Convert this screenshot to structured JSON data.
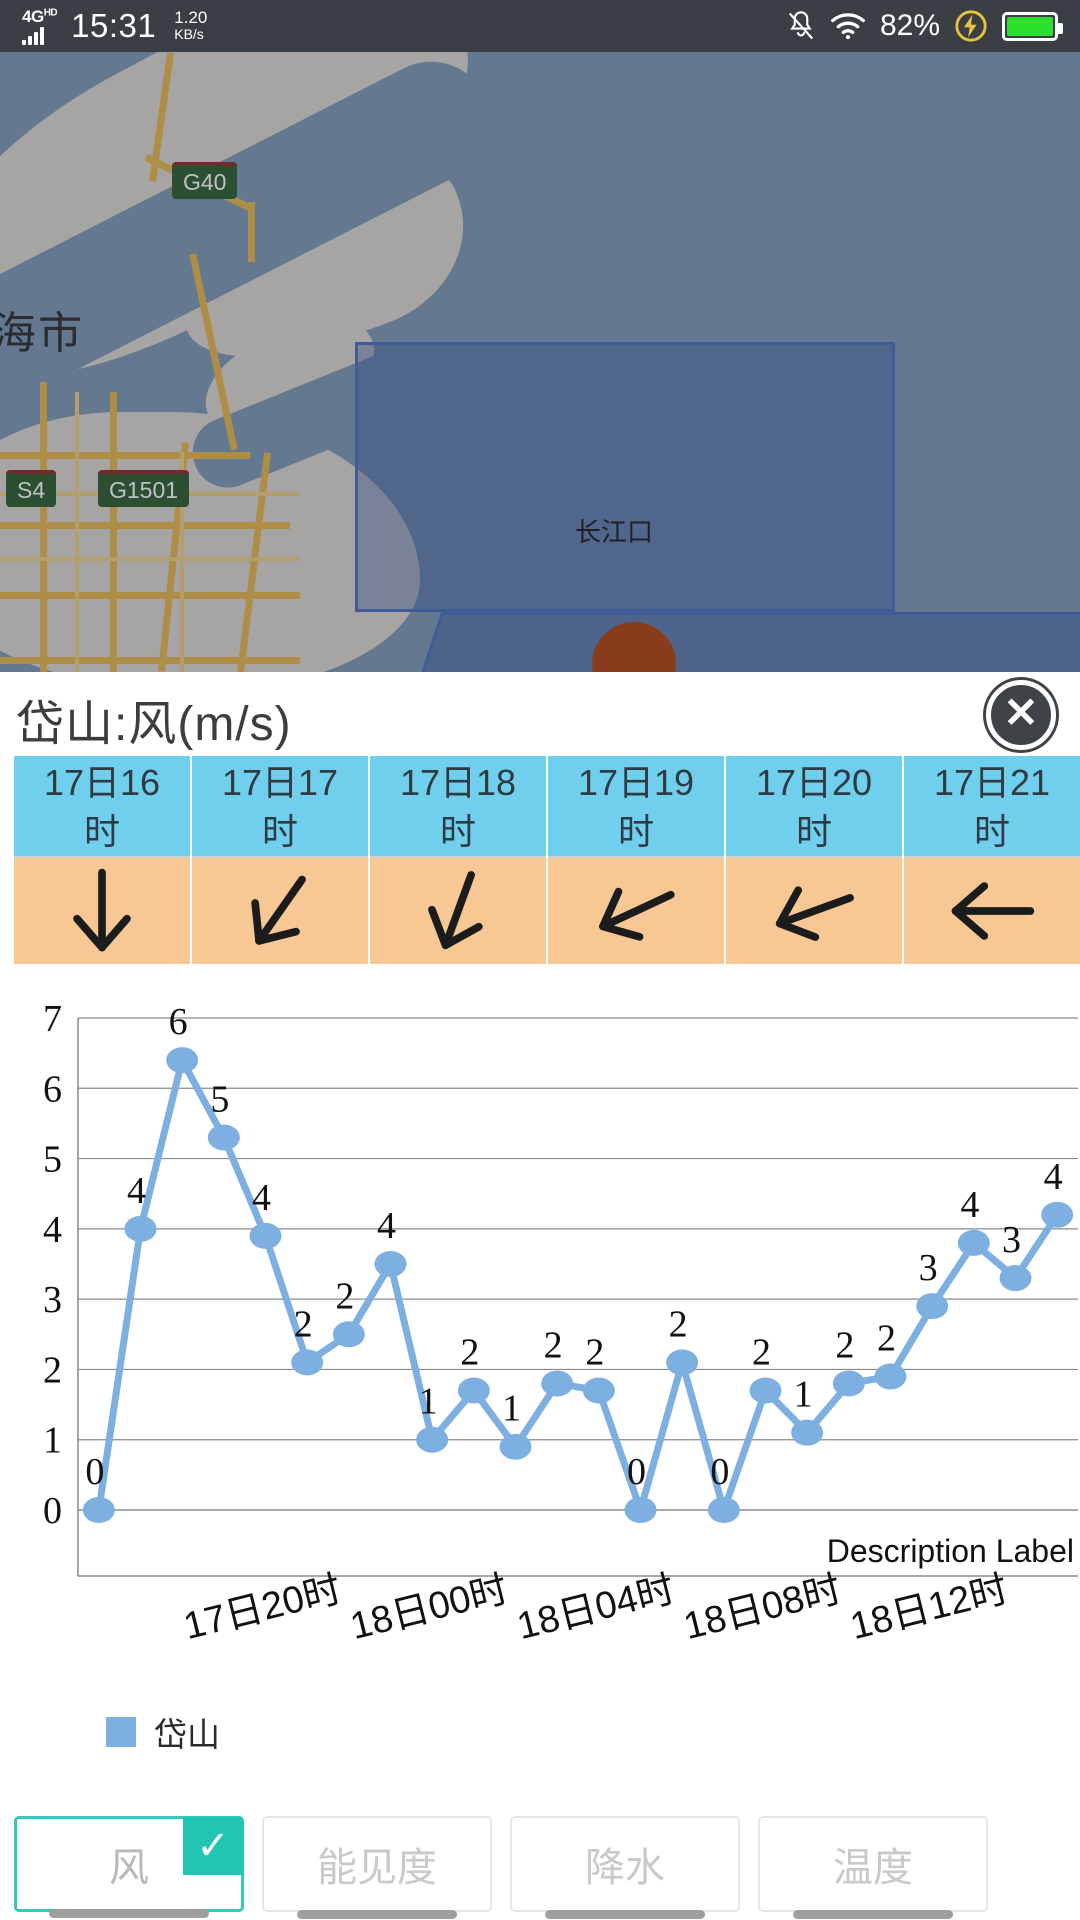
{
  "status_bar": {
    "network": "4G",
    "network_sup": "HD",
    "time": "15:31",
    "speed_value": "1.20",
    "speed_unit": "KB/s",
    "battery_percent": "82%",
    "icons": [
      "signal-bars-icon",
      "mute-bell-icon",
      "wifi-icon",
      "charging-bolt-icon",
      "battery-icon"
    ]
  },
  "map": {
    "city_label": "海市",
    "zone_label": "长江口",
    "road_shields": [
      "G40",
      "S4",
      "G1501"
    ],
    "marker": "location-pin"
  },
  "panel": {
    "title": "岱山:风(m/s)",
    "close_label": "✕"
  },
  "wind_table": {
    "times": [
      {
        "line1": "17日16",
        "line2": "时"
      },
      {
        "line1": "17日17",
        "line2": "时"
      },
      {
        "line1": "17日18",
        "line2": "时"
      },
      {
        "line1": "17日19",
        "line2": "时"
      },
      {
        "line1": "17日20",
        "line2": "时"
      },
      {
        "line1": "17日21",
        "line2": "时"
      }
    ],
    "arrow_angles_deg": [
      180,
      215,
      200,
      245,
      250,
      270
    ],
    "header_color": "#70cfed",
    "arrow_row_color": "#f7c894"
  },
  "chart_data": {
    "type": "line",
    "title": "",
    "xlabel": "",
    "ylabel": "",
    "description_label": "Description Label",
    "ylim": [
      0,
      7
    ],
    "yticks": [
      0,
      1,
      2,
      3,
      4,
      5,
      6,
      7
    ],
    "grid": true,
    "legend_position": "bottom-left",
    "series": [
      {
        "name": "岱山",
        "color": "#7db0e0",
        "values": [
          0,
          4,
          6.4,
          5.3,
          3.9,
          2.1,
          2.5,
          3.5,
          1,
          1.7,
          0.9,
          1.8,
          1.7,
          0,
          2.1,
          0,
          1.7,
          1.1,
          1.8,
          1.9,
          2.9,
          3.8,
          3.3,
          4.2
        ],
        "labels": [
          "0",
          "4",
          "6",
          "5",
          "4",
          "2",
          "2",
          "4",
          "1",
          "2",
          "1",
          "2",
          "2",
          "0",
          "2",
          "0",
          "2",
          "1",
          "2",
          "2",
          "3",
          "4",
          "3",
          "4"
        ]
      }
    ],
    "x_tick_labels": [
      "17日20时",
      "18日00时",
      "18日04时",
      "18日08时",
      "18日12时"
    ],
    "x_tick_indices": [
      4,
      8,
      12,
      16,
      20
    ]
  },
  "legend": {
    "label": "岱山",
    "color": "#7db0e0"
  },
  "tabs": [
    {
      "label": "风",
      "selected": true,
      "check": "✓"
    },
    {
      "label": "能见度",
      "selected": false
    },
    {
      "label": "降水",
      "selected": false
    },
    {
      "label": "温度",
      "selected": false
    }
  ]
}
